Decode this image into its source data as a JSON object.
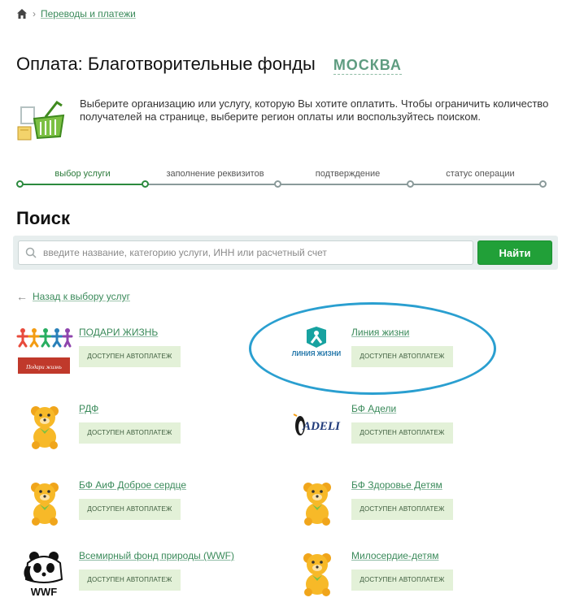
{
  "breadcrumb": {
    "home_icon": "home-icon",
    "link": "Переводы и платежи"
  },
  "header": {
    "title": "Оплата: Благотворительные фонды",
    "region": "МОСКВА"
  },
  "intro": {
    "icon": "shopping-basket-icon",
    "text": "Выберите организацию или услугу, которую Вы хотите оплатить. Чтобы ограничить количество получателей на странице, выберите регион оплаты или воспользуйтесь поиском."
  },
  "steps": [
    {
      "label": "выбор услуги",
      "active": true
    },
    {
      "label": "заполнение реквизитов",
      "active": false
    },
    {
      "label": "подтверждение",
      "active": false
    },
    {
      "label": "статус операции",
      "active": false
    }
  ],
  "search": {
    "heading": "Поиск",
    "placeholder": "введите название, категорию услуги, ИНН или расчетный счет",
    "button": "Найти"
  },
  "back_link": "Назад к выбору услуг",
  "providers": [
    {
      "name": "ПОДАРИ ЖИЗНЬ",
      "badge": "ДОСТУПЕН АВТОПЛАТЕЖ",
      "logo": "podari-zhizn-logo",
      "logo_caption": "Подари жизнь"
    },
    {
      "name": "Линия жизни",
      "badge": "ДОСТУПЕН АВТОПЛАТЕЖ",
      "logo": "liniya-zhizni-logo",
      "logo_caption": "ЛИНИЯ ЖИЗНИ"
    },
    {
      "name": "РДФ",
      "badge": "ДОСТУПЕН АВТОПЛАТЕЖ",
      "logo": "teddy-bear-icon"
    },
    {
      "name": "БФ Адели",
      "badge": "ДОСТУПЕН АВТОПЛАТЕЖ",
      "logo": "adeli-logo",
      "logo_caption": "ADELI"
    },
    {
      "name": "БФ АиФ Доброе сердце",
      "badge": "ДОСТУПЕН АВТОПЛАТЕЖ",
      "logo": "teddy-bear-icon"
    },
    {
      "name": "БФ Здоровье Детям",
      "badge": "ДОСТУПЕН АВТОПЛАТЕЖ",
      "logo": "teddy-bear-icon"
    },
    {
      "name": "Всемирный фонд природы (WWF)",
      "badge": "ДОСТУПЕН АВТОПЛАТЕЖ",
      "logo": "wwf-panda-logo",
      "logo_caption": "WWF"
    },
    {
      "name": "Милосердие-детям",
      "badge": "ДОСТУПЕН АВТОПЛАТЕЖ",
      "logo": "teddy-bear-icon"
    }
  ],
  "colors": {
    "accent_green": "#21a038",
    "link_green": "#3a8a5a",
    "badge_bg": "#e3f1d8",
    "highlight_blue": "#2a9fd0"
  }
}
